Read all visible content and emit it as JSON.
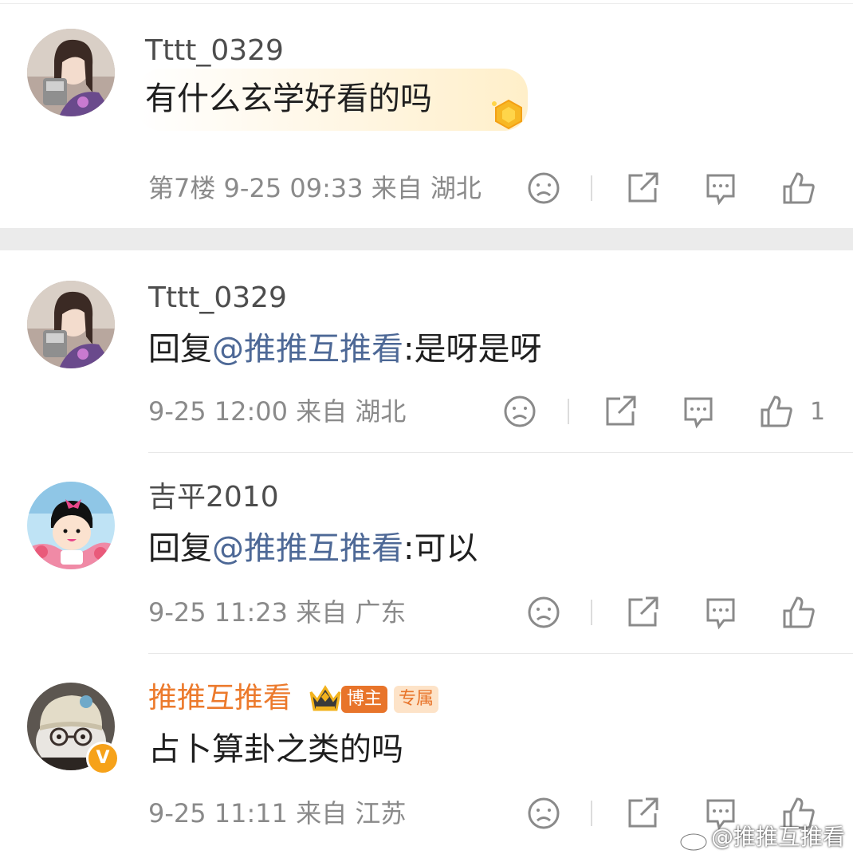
{
  "comments": [
    {
      "username": "Tttt_0329",
      "text": "有什么玄学好看的吗",
      "floor": "第7楼",
      "time": "9-25 09:33",
      "source_prefix": "来自",
      "location": "湖北"
    },
    {
      "username": "Tttt_0329",
      "reply_prefix": "回复",
      "mention": "@推推互推看",
      "text": ":是呀是呀",
      "time": "9-25 12:00",
      "source_prefix": "来自",
      "location": "湖北",
      "like_count": "1"
    },
    {
      "username": "吉平2010",
      "reply_prefix": "回复",
      "mention": "@推推互推看",
      "text": ":可以",
      "time": "9-25 11:23",
      "source_prefix": "来自",
      "location": "广东"
    },
    {
      "username": "推推互推看",
      "badge_owner": "博主",
      "badge_exclusive": "专属",
      "verified_mark": "V",
      "text": "占卜算卦之类的吗",
      "time": "9-25 11:11",
      "source_prefix": "来自",
      "location": "江苏"
    }
  ],
  "icons": {
    "dislike": "sad-face-icon",
    "share": "share-icon",
    "comment": "comment-icon",
    "like": "thumbs-up-icon"
  },
  "watermark": "@推推互推看",
  "colors": {
    "mention": "#4d6896",
    "owner_name": "#ec7a2c",
    "meta": "#8a8a8a"
  }
}
